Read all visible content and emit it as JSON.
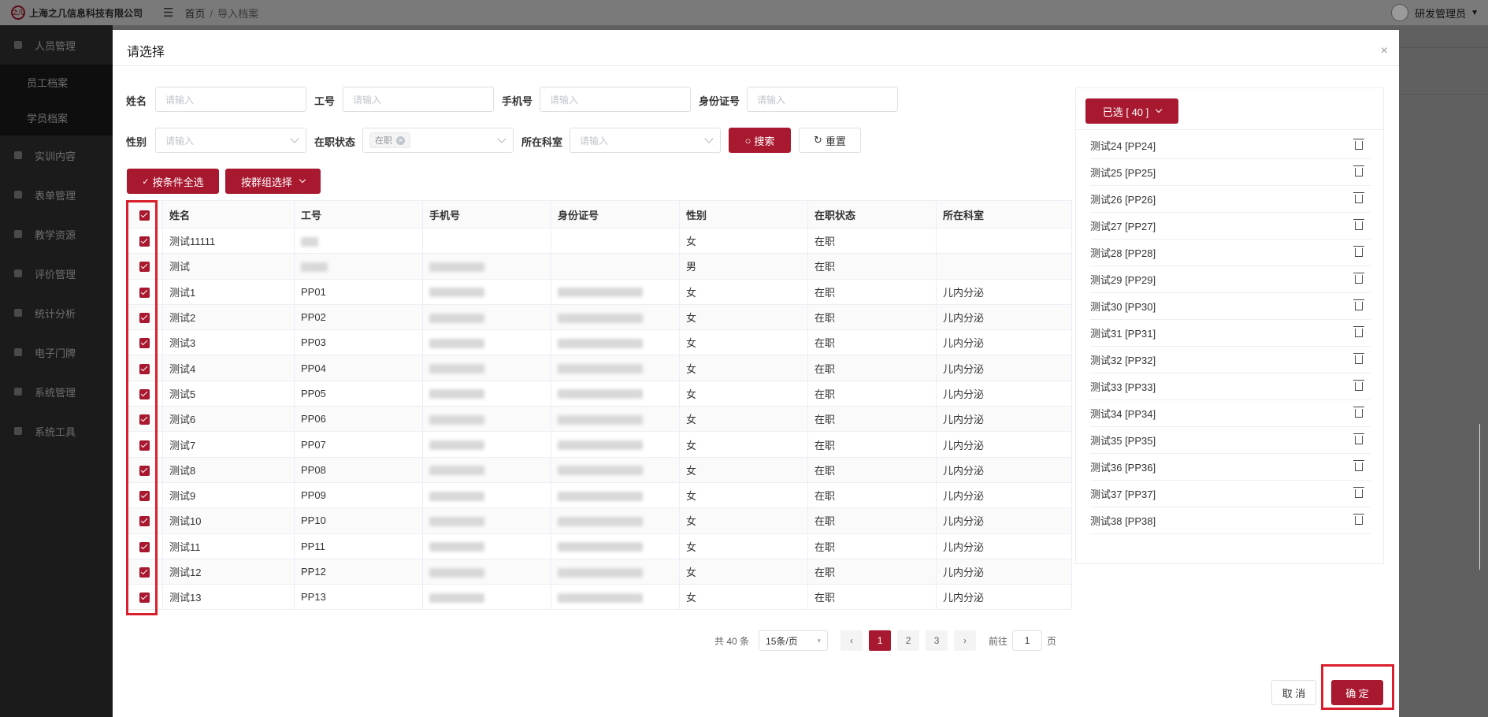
{
  "topbar": {
    "company": "上海之几信息科技有限公司",
    "logo_text": "之几",
    "breadcrumb": [
      "首页",
      "导入档案"
    ],
    "user": "研发管理员"
  },
  "sidebar": {
    "items": [
      "人员管理",
      "员工档案",
      "学员档案",
      "实训内容",
      "表单管理",
      "教学资源",
      "评价管理",
      "统计分析",
      "电子门牌",
      "系统管理",
      "系统工具"
    ]
  },
  "dialog": {
    "title": "请选择",
    "close": "×",
    "form": {
      "name_label": "姓名",
      "id_label": "工号",
      "phone_label": "手机号",
      "idcard_label": "身份证号",
      "gender_label": "性别",
      "status_label": "在职状态",
      "dept_label": "所在科室",
      "placeholder": "请输入",
      "status_tag": "在职"
    },
    "buttons": {
      "search": "搜索",
      "reset": "重置",
      "select_all": "按条件全选",
      "group_select": "按群组选择",
      "cancel": "取 消",
      "confirm": "确 定"
    },
    "table": {
      "headers": [
        "姓名",
        "工号",
        "手机号",
        "身份证号",
        "性别",
        "在职状态",
        "所在科室"
      ],
      "rows": [
        {
          "name": "测试11111",
          "no": "",
          "gender": "女",
          "status": "在职",
          "dept": ""
        },
        {
          "name": "测试",
          "no": "",
          "gender": "男",
          "status": "在职",
          "dept": ""
        },
        {
          "name": "测试1",
          "no": "PP01",
          "gender": "女",
          "status": "在职",
          "dept": "儿内分泌"
        },
        {
          "name": "测试2",
          "no": "PP02",
          "gender": "女",
          "status": "在职",
          "dept": "儿内分泌"
        },
        {
          "name": "测试3",
          "no": "PP03",
          "gender": "女",
          "status": "在职",
          "dept": "儿内分泌"
        },
        {
          "name": "测试4",
          "no": "PP04",
          "gender": "女",
          "status": "在职",
          "dept": "儿内分泌"
        },
        {
          "name": "测试5",
          "no": "PP05",
          "gender": "女",
          "status": "在职",
          "dept": "儿内分泌"
        },
        {
          "name": "测试6",
          "no": "PP06",
          "gender": "女",
          "status": "在职",
          "dept": "儿内分泌"
        },
        {
          "name": "测试7",
          "no": "PP07",
          "gender": "女",
          "status": "在职",
          "dept": "儿内分泌"
        },
        {
          "name": "测试8",
          "no": "PP08",
          "gender": "女",
          "status": "在职",
          "dept": "儿内分泌"
        },
        {
          "name": "测试9",
          "no": "PP09",
          "gender": "女",
          "status": "在职",
          "dept": "儿内分泌"
        },
        {
          "name": "测试10",
          "no": "PP10",
          "gender": "女",
          "status": "在职",
          "dept": "儿内分泌"
        },
        {
          "name": "测试11",
          "no": "PP11",
          "gender": "女",
          "status": "在职",
          "dept": "儿内分泌"
        },
        {
          "name": "测试12",
          "no": "PP12",
          "gender": "女",
          "status": "在职",
          "dept": "儿内分泌"
        },
        {
          "name": "测试13",
          "no": "PP13",
          "gender": "女",
          "status": "在职",
          "dept": "儿内分泌"
        }
      ]
    },
    "pager": {
      "total": "共 40 条",
      "size": "15条/页",
      "pages": [
        "1",
        "2",
        "3"
      ],
      "current": "1",
      "goto_label": "前往",
      "goto_value": "1",
      "page_unit": "页",
      "prev": "‹",
      "next": "›"
    },
    "selected": {
      "title": "已选 [ 40 ]",
      "items": [
        "测试24 [PP24]",
        "测试25 [PP25]",
        "测试26 [PP26]",
        "测试27 [PP27]",
        "测试28 [PP28]",
        "测试29 [PP29]",
        "测试30 [PP30]",
        "测试31 [PP31]",
        "测试32 [PP32]",
        "测试33 [PP33]",
        "测试34 [PP34]",
        "测试35 [PP35]",
        "测试36 [PP36]",
        "测试37 [PP37]",
        "测试38 [PP38]"
      ]
    },
    "colors": {
      "accent": "#a8182f",
      "highlight": "#d91f2d"
    }
  }
}
